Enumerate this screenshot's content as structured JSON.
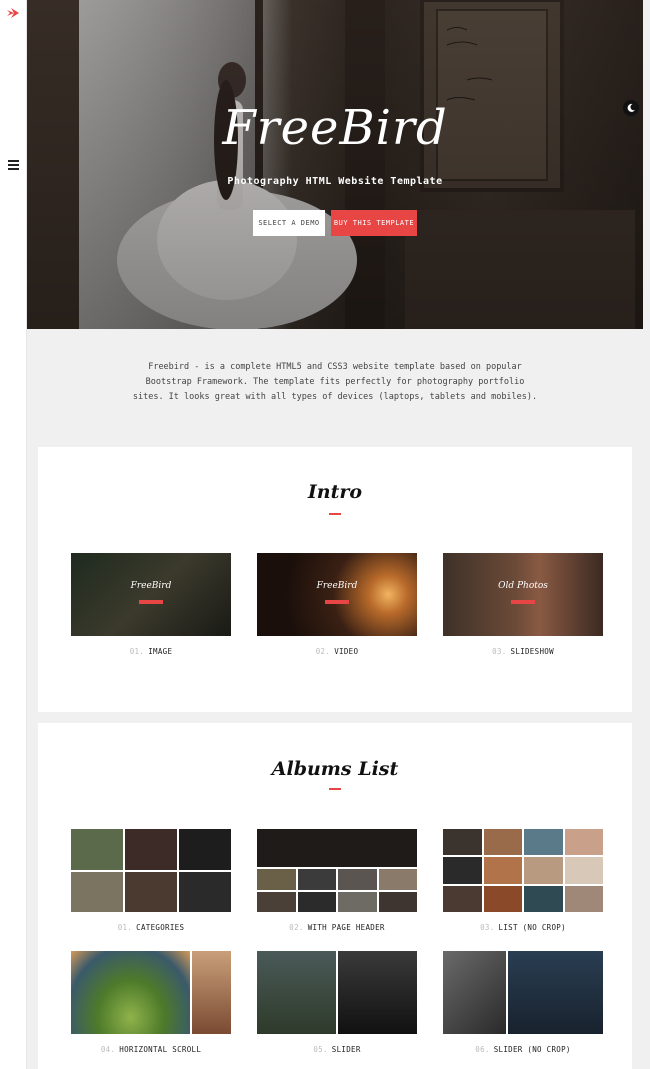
{
  "hero": {
    "brand": "FreeBird",
    "tagline": "Photography HTML Website Template",
    "select_demo_label": "SELECT A DEMO",
    "buy_label": "BUY THIS TEMPLATE"
  },
  "description": {
    "line1": "Freebird - is a complete HTML5 and CSS3 website template based on popular",
    "line2": "Bootstrap Framework. The template fits perfectly for photography portfolio",
    "line3": "sites. It looks great with all types of devices (laptops, tablets and mobiles)."
  },
  "intro": {
    "title": "Intro",
    "items": [
      {
        "num": "01.",
        "label": "IMAGE",
        "mini_title": "FreeBird"
      },
      {
        "num": "02.",
        "label": "VIDEO",
        "mini_title": "FreeBird"
      },
      {
        "num": "03.",
        "label": "SLIDESHOW",
        "mini_title": "Old Photos"
      }
    ]
  },
  "albums": {
    "title": "Albums List",
    "items": [
      {
        "num": "01.",
        "label": "CATEGORIES"
      },
      {
        "num": "02.",
        "label": "WITH PAGE HEADER"
      },
      {
        "num": "03.",
        "label": "LIST (NO CROP)"
      },
      {
        "num": "04.",
        "label": "HORIZONTAL SCROLL"
      },
      {
        "num": "05.",
        "label": "SLIDER"
      },
      {
        "num": "06.",
        "label": "SLIDER (NO CROP)"
      }
    ]
  },
  "icons": {
    "logo": "bird-logo-icon",
    "menu": "hamburger-menu-icon",
    "dark_mode": "moon-icon"
  },
  "colors": {
    "accent": "#e84545",
    "background": "#f0f0f0",
    "card": "#ffffff"
  }
}
